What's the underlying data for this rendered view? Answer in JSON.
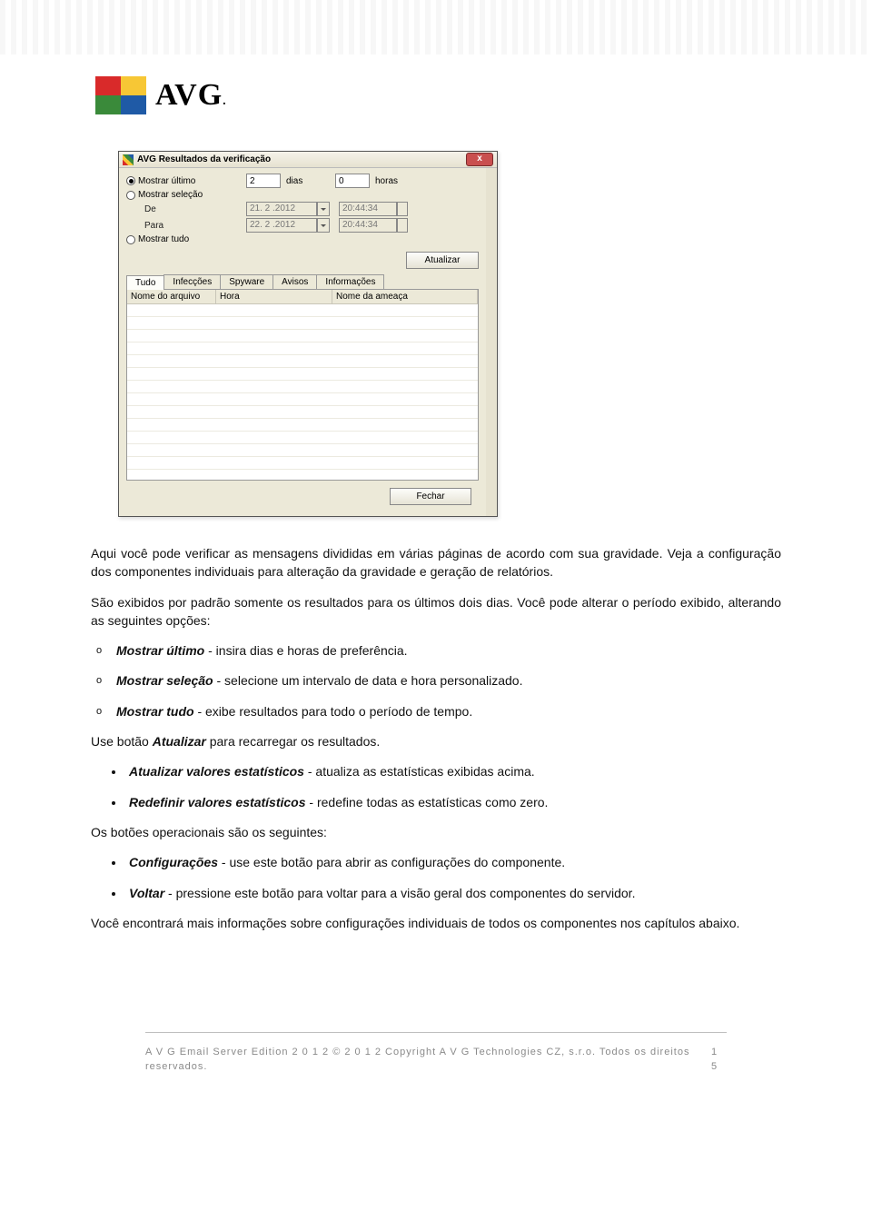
{
  "header": {
    "brand": "AVG"
  },
  "dialog": {
    "title": "AVG Resultados da verificação",
    "radios": {
      "show_last": "Mostrar último",
      "show_selection": "Mostrar seleção",
      "show_all": "Mostrar tudo"
    },
    "days_value": "2",
    "days_label": "dias",
    "hours_value": "0",
    "hours_label": "horas",
    "from_label": "De",
    "to_label": "Para",
    "from_date": "21. 2 .2012",
    "to_date": "22. 2 .2012",
    "from_time": "20:44:34",
    "to_time": "20:44:34",
    "update_btn": "Atualizar",
    "tabs": [
      "Tudo",
      "Infecções",
      "Spyware",
      "Avisos",
      "Informações"
    ],
    "columns": {
      "file": "Nome do arquivo",
      "time": "Hora",
      "threat": "Nome da ameaça"
    },
    "close_btn": "Fechar"
  },
  "doc": {
    "p1": " Aqui você pode verificar as mensagens divididas em várias páginas de acordo com sua gravidade. Veja a configuração dos componentes individuais para alteração da gravidade e geração de relatórios.",
    "p2": "São exibidos por padrão somente os resultados para os últimos dois dias. Você pode alterar o período exibido, alterando as seguintes opções:",
    "li1_b": "Mostrar último",
    "li1_t": " - insira dias e horas de preferência.",
    "li2_b": "Mostrar seleção",
    "li2_t": " - selecione um intervalo de data e hora personalizado.",
    "li3_b": "Mostrar tudo",
    "li3_t": " - exibe resultados para todo o período de tempo.",
    "p3a": "Use botão ",
    "p3b": "Atualizar",
    "p3c": " para recarregar os resultados.",
    "b1_b": "Atualizar valores estatísticos",
    "b1_t": " - atualiza as estatísticas exibidas acima.",
    "b2_b": "Redefinir valores estatísticos",
    "b2_t": " - redefine todas as estatísticas como zero.",
    "p4": "Os botões operacionais são os seguintes:",
    "c1_b": "Configurações",
    "c1_t": " - use este botão para abrir as configurações do componente.",
    "c2_b": "Voltar",
    "c2_t": " - pressione este botão para voltar para a visão geral dos componentes do servidor.",
    "p5": "Você encontrará mais informações sobre configurações individuais de todos os componentes nos capítulos abaixo."
  },
  "footer": {
    "left": "A V G  Email Server Edition 2 0 1 2  © 2 0 1 2  Copyright A V G  Technologies CZ, s.r.o. Todos os direitos reservados.",
    "page": "1 5"
  }
}
